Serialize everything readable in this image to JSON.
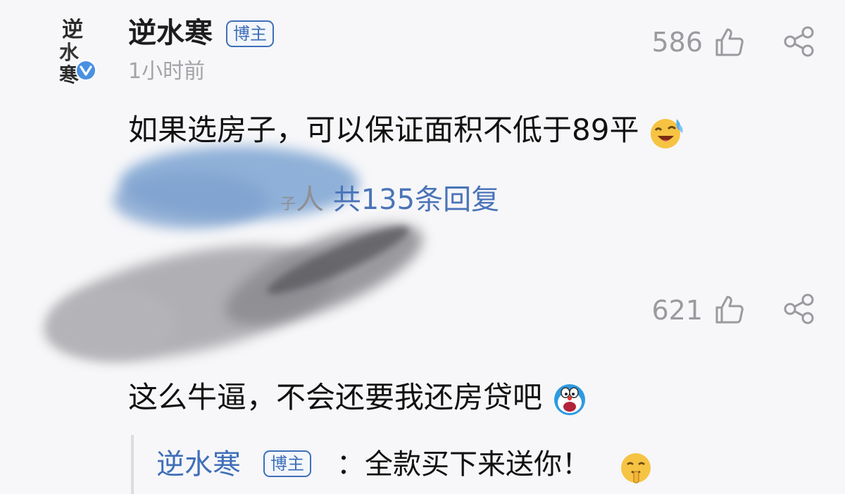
{
  "comment1": {
    "author": "逆水寒",
    "badge": "博主",
    "time": "1小时前",
    "likes": "586",
    "text": "如果选房子，可以保证面积不低于89平",
    "replies_hint": "人",
    "replies_prefix": "子",
    "replies_link": "共135条回复",
    "avatar_text": [
      "逆",
      "水",
      "寒"
    ]
  },
  "comment2": {
    "likes": "621",
    "text": "这么牛逼，不会还要我还房贷吧",
    "reply": {
      "author": "逆水寒",
      "badge": "博主",
      "text": "：全款买下来送你！"
    }
  },
  "colors": {
    "link_blue": "#3f6fb8",
    "verified_blue": "#4a90e2",
    "meta_gray": "#9a9a9f"
  },
  "icons": [
    "thumbs-up-icon",
    "share-icon",
    "verified-icon",
    "laughing-tears-emoji",
    "doraemon-emoji",
    "shush-emoji"
  ]
}
